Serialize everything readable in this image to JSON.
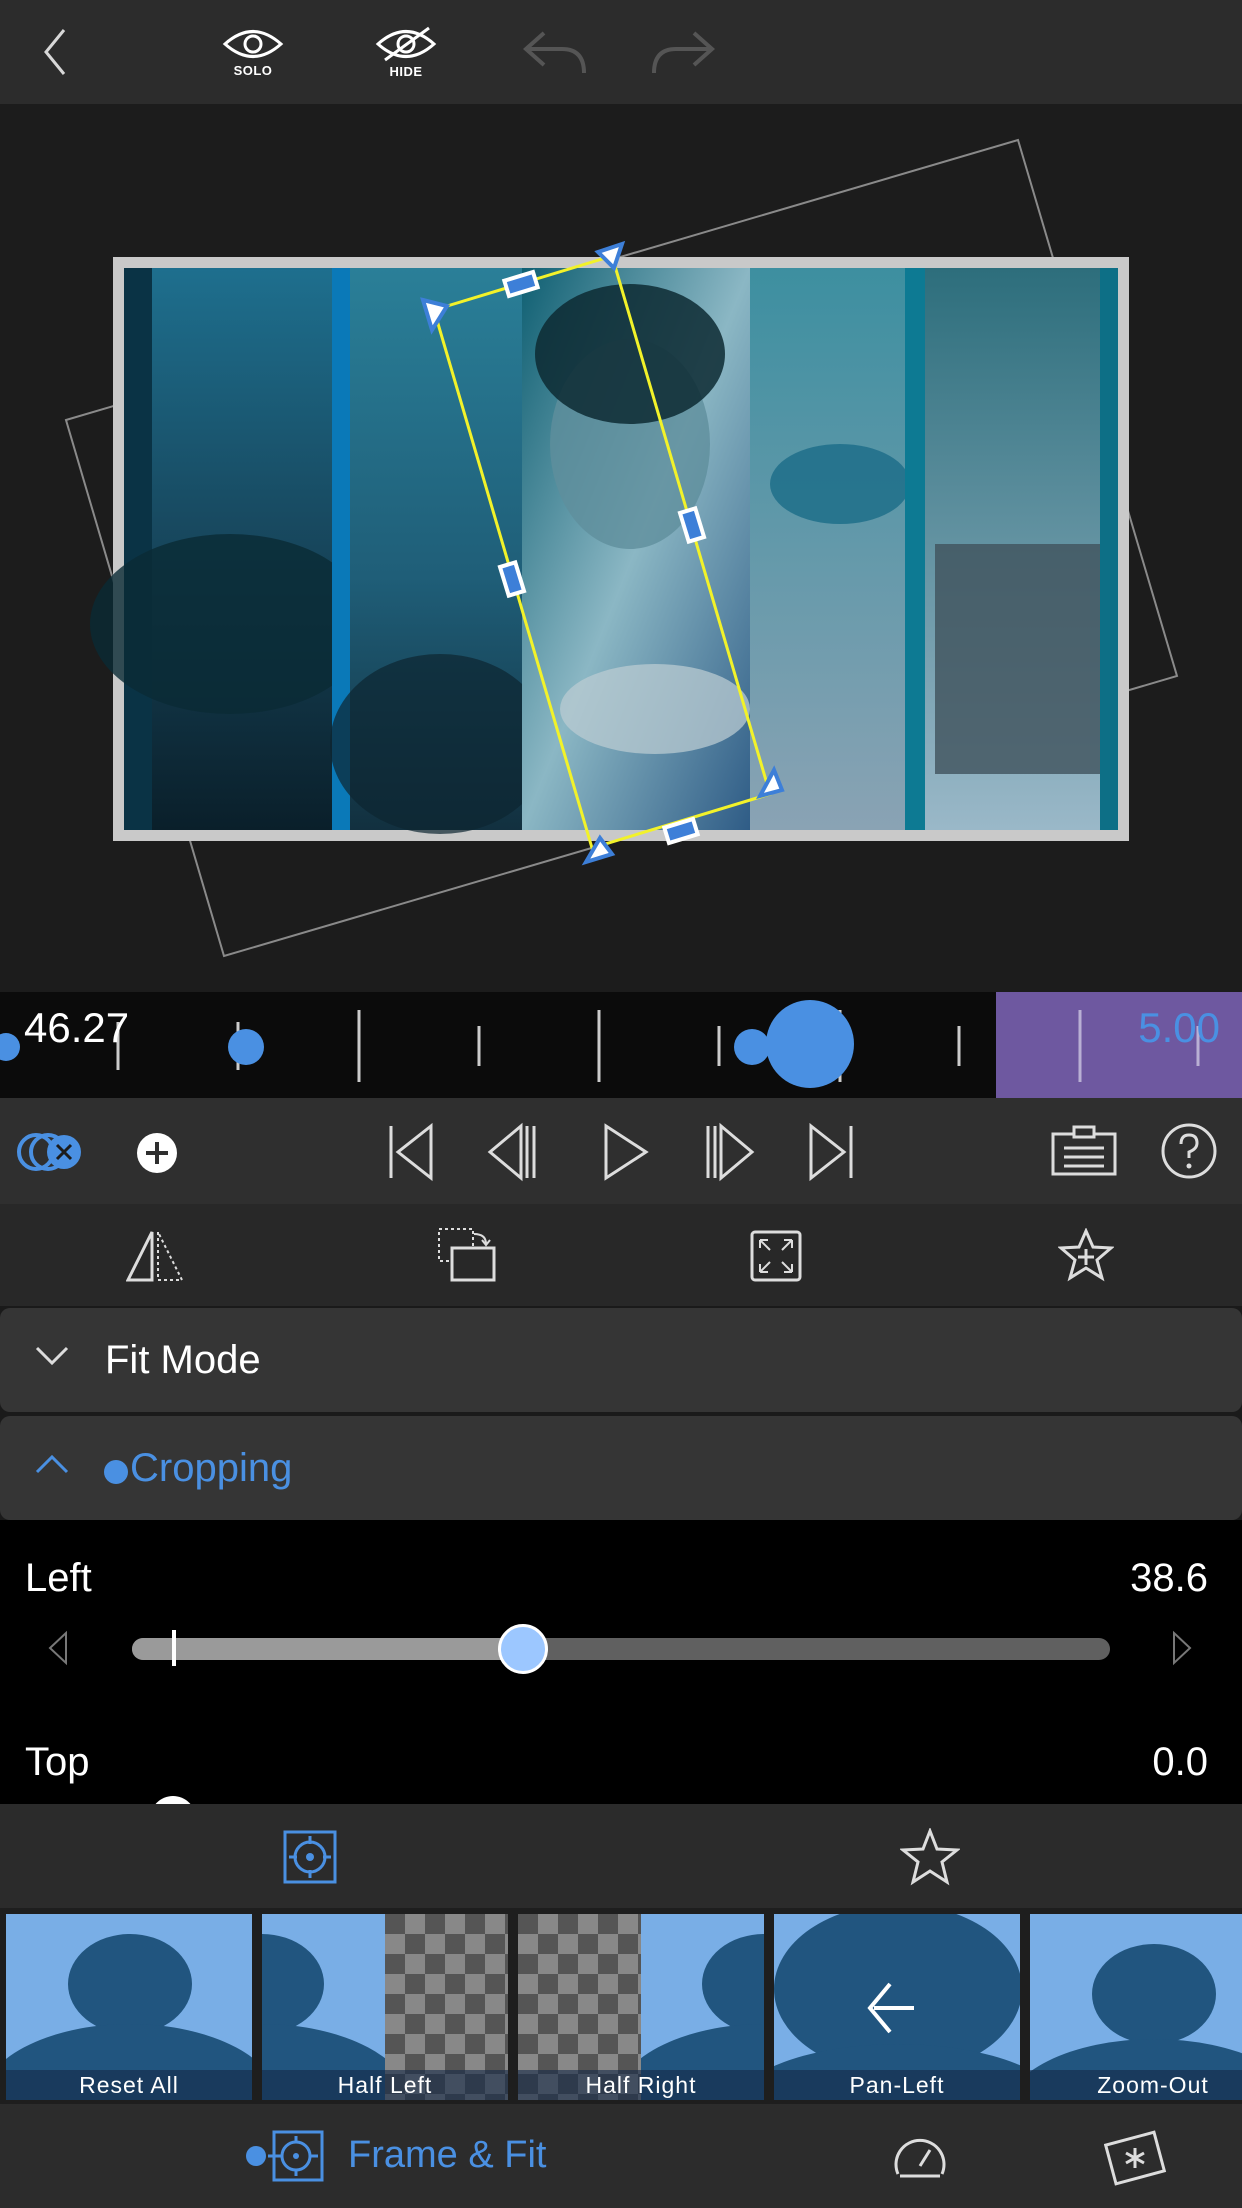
{
  "toolbar": {
    "back_icon": "chevron-left-icon",
    "solo_label": "SOLO",
    "hide_label": "HIDE",
    "undo_icon": "undo-icon",
    "redo_icon": "redo-icon"
  },
  "timeline": {
    "current_time": "46.27",
    "clip_duration": "5.00"
  },
  "transport": {
    "icons": [
      "layers-icon",
      "add-icon",
      "skip-start-icon",
      "step-back-icon",
      "play-icon",
      "step-forward-icon",
      "skip-end-icon",
      "clipboard-icon",
      "help-icon"
    ]
  },
  "tools": {
    "icons": [
      "flip-icon",
      "rotate-crop-icon",
      "fit-frame-icon",
      "favorite-add-icon"
    ]
  },
  "sections": {
    "fit_mode": "Fit Mode",
    "cropping": "Cropping"
  },
  "params": {
    "left_label": "Left",
    "left_value": "38.6",
    "left_fraction": 0.4,
    "top_label": "Top",
    "top_value": "0.0"
  },
  "tabs": {
    "icons": [
      "target-icon",
      "star-icon"
    ]
  },
  "presets": [
    {
      "label": "Reset All"
    },
    {
      "label": "Half Left"
    },
    {
      "label": "Half Right"
    },
    {
      "label": "Pan-Left"
    },
    {
      "label": "Zoom-Out"
    }
  ],
  "bottom": {
    "title": "Frame & Fit",
    "icons": [
      "speedometer-icon",
      "effects-icon"
    ]
  },
  "colors": {
    "accent": "#4a90e2",
    "crop_outline": "#f2f22a",
    "timeline_clip": "#6e58a0"
  }
}
